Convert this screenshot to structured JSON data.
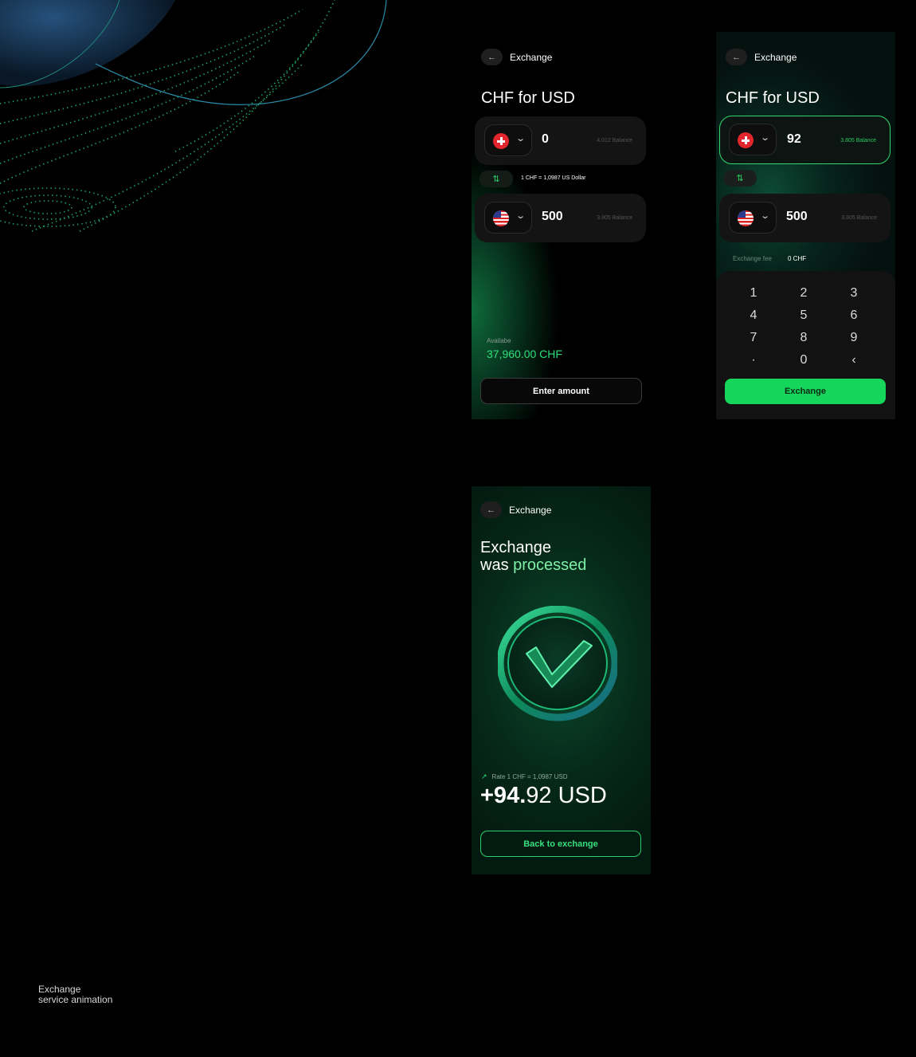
{
  "caption": {
    "line1": "Exchange",
    "line2": "service animation"
  },
  "screen1": {
    "header_title": "Exchange",
    "title": "CHF for USD",
    "from": {
      "currency_icon": "swiss-flag-icon",
      "amount": "0",
      "balance": "4.012 Balance"
    },
    "rate": "1 CHF = 1,0987 US Dollar",
    "to": {
      "currency_icon": "us-flag-icon",
      "amount": "500",
      "balance": "3.805 Balance"
    },
    "available_label": "Availabe",
    "available_value": "37,960.00 CHF",
    "button": "Enter amount"
  },
  "screen2": {
    "header_title": "Exchange",
    "title": "CHF for USD",
    "from": {
      "currency_icon": "swiss-flag-icon",
      "amount": "92",
      "balance": "3.805 Balance"
    },
    "to": {
      "currency_icon": "us-flag-icon",
      "amount": "500",
      "balance": "3.805 Balance"
    },
    "fee_label": "Exchange fee",
    "fee_value": "0 CHF",
    "keys": [
      "1",
      "2",
      "3",
      "4",
      "5",
      "6",
      "7",
      "8",
      "9",
      "·",
      "0",
      "‹"
    ],
    "button": "Exchange"
  },
  "screen3": {
    "header_title": "Exchange",
    "title_line1": "Exchange",
    "title_line2_a": "was ",
    "title_line2_b": "processed",
    "rate": "Rate 1 CHF = 1,0987 USD",
    "result_bold": "+94.",
    "result_rest": "92 USD",
    "button": "Back to exchange"
  },
  "colors": {
    "accent": "#15d55a",
    "background": "#000000"
  }
}
